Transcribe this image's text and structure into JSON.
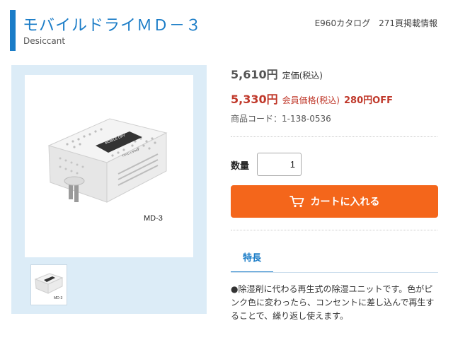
{
  "header": {
    "title": "モバイルドライＭＤ－３",
    "subtitle": "Desiccant",
    "catalog_info": "E960カタログ　271頁掲載情報"
  },
  "image": {
    "model_label": "MD-3",
    "device_brand_text": "MOBILE DRY",
    "device_maker_text": "TOYO LIVING",
    "thumb_label": "MD-3"
  },
  "pricing": {
    "list_price": "5,610円",
    "list_price_label": "定価(税込)",
    "member_price": "5,330円",
    "member_price_label": "会員価格(税込)",
    "discount": "280円OFF",
    "product_code": "商品コード：1-138-0536"
  },
  "quantity": {
    "label": "数量",
    "value": "1"
  },
  "cart": {
    "button_label": "カートに入れる",
    "icon": "cart-icon"
  },
  "tabs": [
    {
      "label": "特長",
      "active": true
    }
  ],
  "description": "●除湿剤に代わる再生式の除湿ユニットです。色がピンク色に変わったら、コンセントに差し込んで再生することで、繰り返し使えます。",
  "colors": {
    "accent": "#1a7cc7",
    "price_red": "#c0392b",
    "cart_orange": "#f4661b",
    "image_panel_bg": "#dcecf7"
  }
}
